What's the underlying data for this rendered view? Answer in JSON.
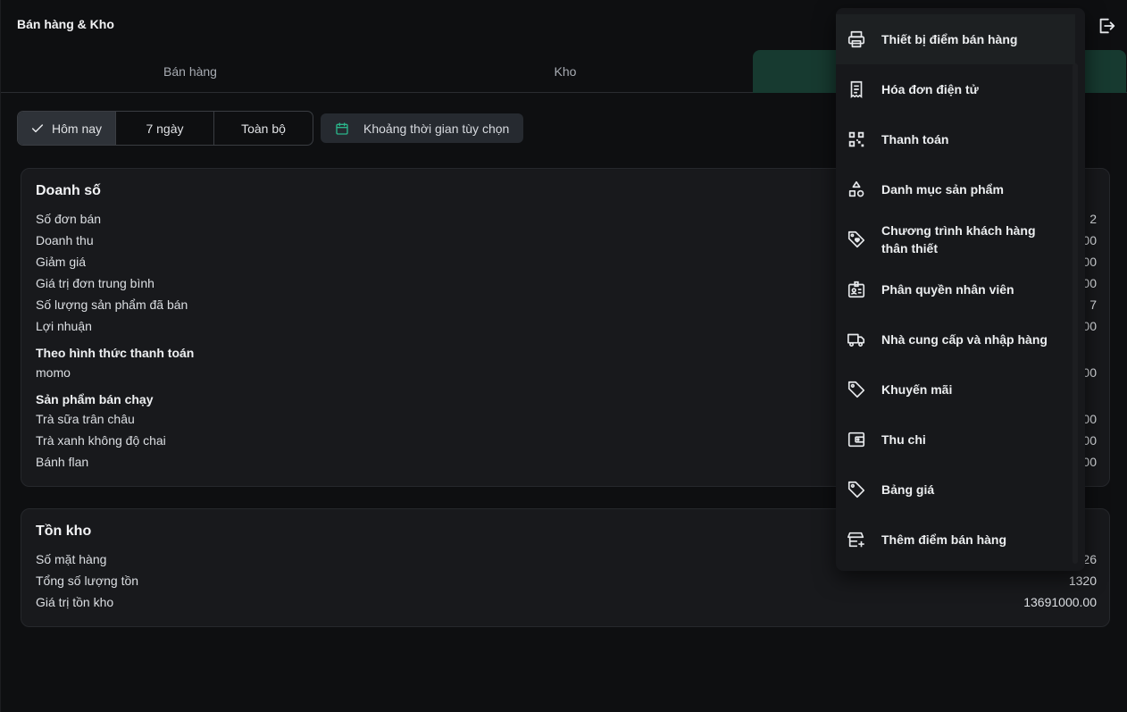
{
  "header": {
    "title": "Bán hàng & Kho",
    "logout_icon": "logout-icon"
  },
  "tabs": [
    {
      "label": "Bán hàng"
    },
    {
      "label": "Kho"
    },
    {
      "label": ""
    }
  ],
  "filters": {
    "segments": [
      {
        "label": "Hôm nay",
        "active": true
      },
      {
        "label": "7 ngày",
        "active": false
      },
      {
        "label": "Toàn bộ",
        "active": false
      }
    ],
    "custom_range": "Khoảng thời gian tùy chọn"
  },
  "sales": {
    "title": "Doanh số",
    "rows": [
      {
        "label": "Số đơn bán",
        "value": "2"
      },
      {
        "label": "Doanh thu",
        "value": "00"
      },
      {
        "label": "Giảm giá",
        "value": "00"
      },
      {
        "label": "Giá trị đơn trung bình",
        "value": "00"
      },
      {
        "label": "Số lượng sản phẩm đã bán",
        "value": "7"
      },
      {
        "label": "Lợi nhuận",
        "value": "00"
      }
    ],
    "payment": {
      "title": "Theo hình thức thanh toán",
      "rows": [
        {
          "label": "momo",
          "value": "00"
        }
      ]
    },
    "best_sellers": {
      "title": "Sản phẩm bán chạy",
      "rows": [
        {
          "label": "Trà sữa trân châu",
          "value": "00"
        },
        {
          "label": "Trà xanh không độ chai",
          "value": "00"
        },
        {
          "label": "Bánh flan",
          "value": "00"
        }
      ]
    }
  },
  "stock": {
    "title": "Tồn kho",
    "rows": [
      {
        "label": "Số mặt hàng",
        "value": "26"
      },
      {
        "label": "Tổng số lượng tồn",
        "value": "1320"
      },
      {
        "label": "Giá trị tồn kho",
        "value": "13691000.00"
      }
    ]
  },
  "menu": {
    "items": [
      {
        "label": "Thiết bị điểm bán hàng",
        "icon": "printer-icon"
      },
      {
        "label": "Hóa đơn điện tử",
        "icon": "receipt-icon"
      },
      {
        "label": "Thanh toán",
        "icon": "qr-code-icon"
      },
      {
        "label": "Danh mục sản phẩm",
        "icon": "shapes-icon"
      },
      {
        "label": "Chương trình khách hàng thân thiết",
        "icon": "tag-heart-icon"
      },
      {
        "label": "Phân quyền nhân viên",
        "icon": "id-badge-icon"
      },
      {
        "label": "Nhà cung cấp và nhập hàng",
        "icon": "truck-icon"
      },
      {
        "label": "Khuyến mãi",
        "icon": "tag-icon"
      },
      {
        "label": "Thu chi",
        "icon": "wallet-icon"
      },
      {
        "label": "Bảng giá",
        "icon": "price-tag-icon"
      },
      {
        "label": "Thêm điểm bán hàng",
        "icon": "store-add-icon"
      }
    ]
  },
  "colors": {
    "accent": "#2bb58a",
    "active_tab": "#173a30"
  }
}
